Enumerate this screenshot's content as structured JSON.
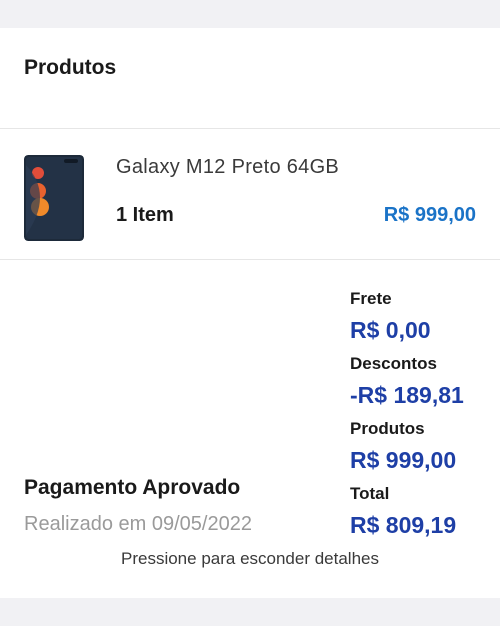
{
  "products": {
    "title": "Produtos",
    "items": [
      {
        "image_icon": "phone-product-image",
        "name": "Galaxy M12 Preto 64GB",
        "quantity": "1 Item",
        "price": "R$ 999,00"
      }
    ]
  },
  "summary": {
    "shipping_label": "Frete",
    "shipping_value": "R$ 0,00",
    "discount_label": "Descontos",
    "discount_value": "-R$ 189,81",
    "products_label": "Produtos",
    "products_value": "R$ 999,00",
    "total_label": "Total",
    "total_value": "R$ 809,19"
  },
  "payment": {
    "status": "Pagamento Aprovado",
    "date": "Realizado em 09/05/2022"
  },
  "toggle_details": "Pressione para esconder detalhes",
  "colors": {
    "price_accent": "#1a73c7",
    "summary_value": "#1e3fa6",
    "background": "#f1f1f4"
  }
}
